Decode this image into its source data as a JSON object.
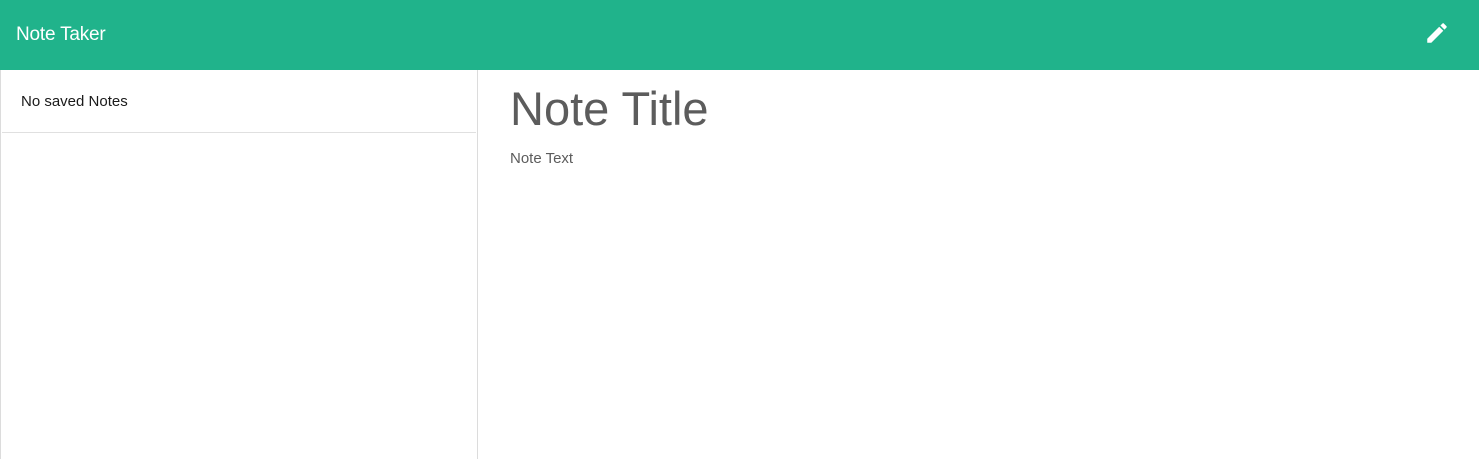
{
  "colors": {
    "navbar_bg": "#20b38b",
    "navbar_text": "#ffffff",
    "body_text": "#5c5c5c"
  },
  "header": {
    "brand": "Note Taker",
    "new_note_icon": "pencil-icon"
  },
  "sidebar": {
    "items": [
      {
        "label": "No saved Notes"
      }
    ]
  },
  "editor": {
    "title_placeholder": "Note Title",
    "text_placeholder": "Note Text",
    "title_value": "",
    "text_value": ""
  }
}
